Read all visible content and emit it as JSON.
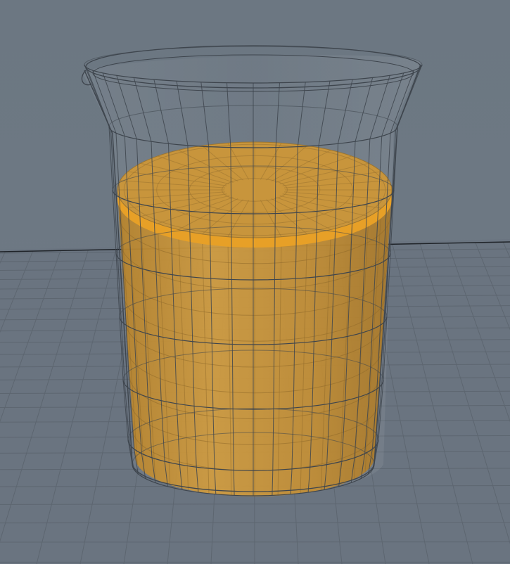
{
  "viewport": {
    "view": "perspective",
    "colors": {
      "background": "#6f7a85",
      "background_top": "#6c7782",
      "floor": "#6a7480",
      "grid_line": "#5d6670",
      "horizon_line": "#1f2328",
      "wireframe": "#3e454d",
      "liquid_body": "#c99539",
      "liquid_top": "#c8953c",
      "liquid_rim": "#e7a027"
    }
  },
  "scene": {
    "objects": [
      {
        "type": "beaker",
        "material": "glass",
        "display": "wireframe"
      },
      {
        "type": "liquid",
        "display": "shaded"
      }
    ]
  }
}
